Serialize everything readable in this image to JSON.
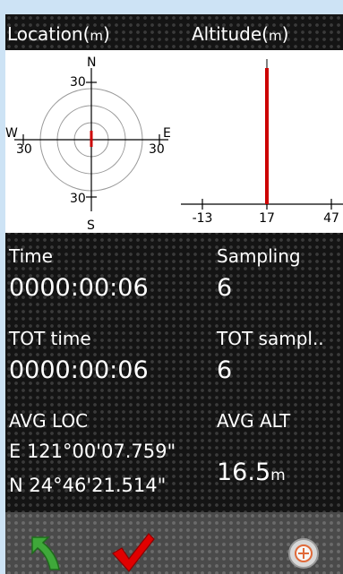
{
  "header": {
    "location_title": "Location(",
    "location_unit": "m",
    "altitude_title": "Altitude(",
    "altitude_unit": "m",
    "close_paren": ")"
  },
  "location_chart": {
    "north": "N",
    "south": "S",
    "east": "E",
    "west": "W",
    "tick_top": "30",
    "tick_bottom": "30",
    "tick_left": "30",
    "tick_right": "30"
  },
  "chart_data": {
    "type": "bar",
    "x": [
      17
    ],
    "values": [
      1
    ],
    "tick_labels": [
      "-13",
      "17",
      "47"
    ],
    "xlim": [
      -13,
      47
    ],
    "bar_color": "#cc0000"
  },
  "stats": {
    "time_label": "Time",
    "time_value": "0000:00:06",
    "sampling_label": "Sampling",
    "sampling_value": "6",
    "tot_time_label": "TOT time",
    "tot_time_value": "0000:00:06",
    "tot_sampling_label": "TOT sampl..",
    "tot_sampling_value": "6",
    "avg_loc_label": "AVG LOC",
    "avg_loc_east": "E 121°00'07.759\"",
    "avg_loc_north": "N  24°46'21.514\"",
    "avg_alt_label": "AVG ALT",
    "avg_alt_value": "16.5",
    "avg_alt_unit": "m"
  },
  "toolbar": {
    "icons": [
      "back-arrow-icon",
      "checkmark-icon",
      "target-icon"
    ]
  }
}
